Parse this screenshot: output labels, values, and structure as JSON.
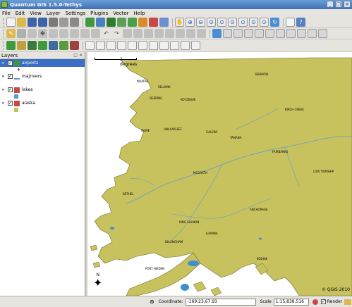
{
  "window": {
    "title": "Quantum GIS 1.5.0-Tethys",
    "controls": [
      "_",
      "□",
      "×"
    ]
  },
  "menu": [
    "File",
    "Edit",
    "View",
    "Layer",
    "Settings",
    "Plugins",
    "Vector",
    "Help"
  ],
  "sidebar": {
    "title": "Layers",
    "header_buttons": [
      "□",
      "×"
    ],
    "layers": [
      {
        "name": "airports",
        "checked": true,
        "selected": true
      },
      {
        "name": "majrivers",
        "checked": true,
        "selected": false
      },
      {
        "name": "lakes",
        "checked": true,
        "selected": false
      },
      {
        "name": "alaska",
        "checked": true,
        "selected": false
      }
    ],
    "colors": {
      "lakes": "#5b9bd5",
      "alaska": "#c8c25e",
      "rivers": "#5b9bd5"
    }
  },
  "map": {
    "scale_label": "1 degrees",
    "copyright": "© QGIS 2010",
    "north": "N",
    "background_land_color": "#c8c25e",
    "lake_color": "#3a8fcf",
    "labels": [
      "DEERING",
      "KOTZEBUE",
      "NOME",
      "UNALAKLEET",
      "BETHEL",
      "DILLINGHAM",
      "KING SALMON",
      "ANCHORAGE",
      "FAIRBANKS",
      "BARROW",
      "TANANA",
      "GALENA",
      "MCGRATH",
      "KODIAK",
      "LOW TWNSHIP",
      "ILIAMNA",
      "SELAWIK",
      "NOATAK",
      "BIRCH CREEK",
      "PORT HEIDEN"
    ]
  },
  "status": {
    "coordinate_label": "Coordinate:",
    "coordinate_value": "-169.23,67.93",
    "scale_label": "Scale",
    "scale_value": "1:15,838,516",
    "render_label": "Render",
    "render_checked": true
  }
}
